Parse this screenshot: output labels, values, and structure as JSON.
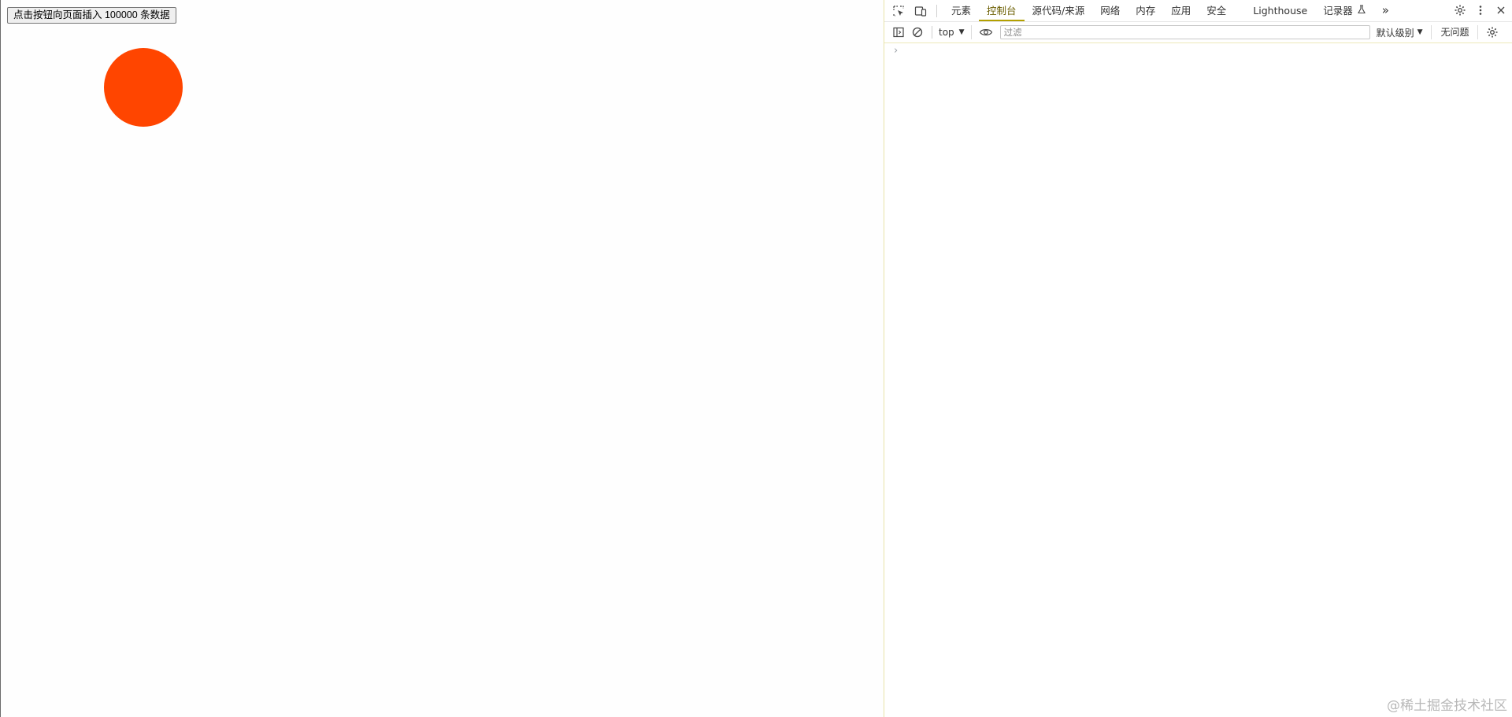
{
  "page": {
    "insert_button_label": "点击按钮向页面插入 100000 条数据",
    "ball_color": "#ff4500"
  },
  "devtools": {
    "tabs": [
      {
        "label": "元素"
      },
      {
        "label": "控制台",
        "active": true
      },
      {
        "label": "源代码/来源"
      },
      {
        "label": "网络"
      },
      {
        "label": "内存"
      },
      {
        "label": "应用"
      },
      {
        "label": "安全"
      },
      {
        "label": "Lighthouse"
      },
      {
        "label": "记录器"
      }
    ],
    "more_tabs_glyph": "»",
    "toolbar": {
      "context": "top",
      "filter_placeholder": "过滤",
      "level": "默认级别",
      "issues": "无问题"
    },
    "prompt_glyph": "›",
    "accent_color": "#b3a000"
  },
  "watermark": "@稀土掘金技术社区",
  "icons": [
    "inspect-element-icon",
    "device-toolbar-icon",
    "flask-icon",
    "gear-icon",
    "kebab-menu-icon",
    "close-icon",
    "sidebar-toggle-icon",
    "clear-console-icon",
    "eye-icon",
    "console-settings-icon"
  ]
}
